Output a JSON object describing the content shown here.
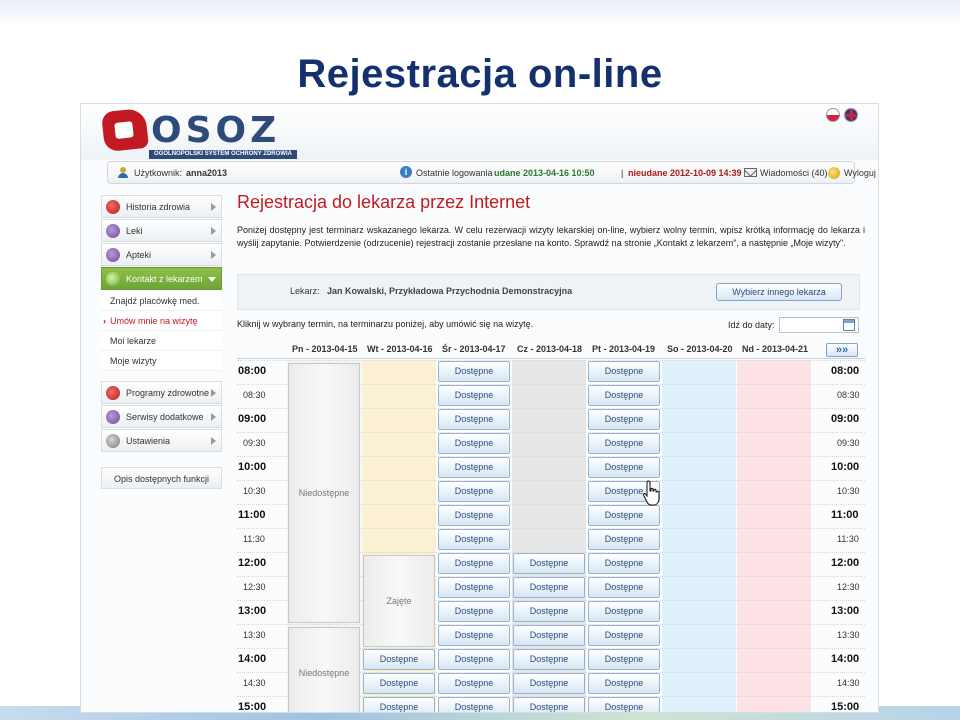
{
  "slide_title": "Rejestracja on-line",
  "logo": {
    "text": "OSOZ",
    "subtitle": "OGÓLNOPOLSKI SYSTEM OCHRONY ZDROWIA"
  },
  "user_bar": {
    "user_label": "Użytkownik:",
    "user_name": "anna2013",
    "last_login_label": "Ostatnie logowania",
    "last_ok": "udane 2013-04-16 10:50",
    "separator": "|",
    "last_fail": "nieudane 2012-10-09 14:39",
    "messages": "Wiadomości (40)",
    "logout": "Wyloguj"
  },
  "sidebar": {
    "items": [
      {
        "label": "Historia zdrowia",
        "icon": "heart-icon"
      },
      {
        "label": "Leki",
        "icon": "pill-icon"
      },
      {
        "label": "Apteki",
        "icon": "pharmacy-icon"
      },
      {
        "label": "Kontakt z lekarzem",
        "icon": "doctor-icon",
        "active": true
      }
    ],
    "sub_items": [
      "Znajdź placówkę med.",
      "Umów mnie na wizytę",
      "Moi lekarze",
      "Moje wizyty"
    ],
    "items2": [
      {
        "label": "Programy zdrowotne",
        "icon": "program-icon"
      },
      {
        "label": "Serwisy dodatkowe",
        "icon": "services-icon"
      },
      {
        "label": "Ustawienia",
        "icon": "settings-icon"
      }
    ],
    "functions_link": "Opis dostępnych funkcji"
  },
  "main": {
    "title": "Rejestracja do lekarza przez Internet",
    "intro": "Poniżej dostępny jest terminarz wskazanego lekarza. W celu rezerwacji wizyty lekarskiej on-line, wybierz wolny termin, wpisz krótką informację do lekarza i wyślij zapytanie. Potwierdzenie (odrzucenie) rejestracji zostanie przesłane na konto. Sprawdź na stronie „Kontakt z lekarzem\", a następnie „Moje wizyty\".",
    "doctor_label": "Lekarz:",
    "doctor_name": "Jan Kowalski, Przykładowa Przychodnia Demonstracyjna",
    "change_doctor": "Wybierz innego lekarza",
    "instruction": "Kliknij w wybrany termin, na terminarzu poniżej, aby umówić się na wizytę.",
    "date_label": "Idź do daty:",
    "date_value": "",
    "next_week": "»»"
  },
  "schedule": {
    "days": [
      "Pn - 2013-04-15",
      "Wt - 2013-04-16",
      "Śr - 2013-04-17",
      "Cz - 2013-04-18",
      "Pt - 2013-04-19",
      "So - 2013-04-20",
      "Nd - 2013-04-21"
    ],
    "day_colors": [
      "#f4f4f4",
      "#fbefd4",
      "#ffffff",
      "#e6e6e6",
      "#ffffff",
      "#dff1fb",
      "#fde3e5"
    ],
    "times": [
      "08:00",
      "08:30",
      "09:00",
      "09:30",
      "10:00",
      "10:30",
      "11:00",
      "11:30",
      "12:00",
      "12:30",
      "13:00",
      "13:30",
      "14:00",
      "14:30",
      "15:00"
    ],
    "available_label": "Dostępne",
    "unavailable_label": "Niedostępne",
    "busy_label": "Zajęte",
    "slots": [
      {
        "day": 2,
        "from": 0,
        "to": 14
      },
      {
        "day": 4,
        "from": 0,
        "to": 14
      },
      {
        "day": 3,
        "from": 8,
        "to": 14
      },
      {
        "day": 1,
        "from": 12,
        "to": 14
      }
    ],
    "blocks": [
      {
        "day": 0,
        "from": 0,
        "to": 11,
        "kind": "unavailable"
      },
      {
        "day": 0,
        "from": 11,
        "to": 15,
        "kind": "unavailable"
      },
      {
        "day": 1,
        "from": 8,
        "to": 12,
        "kind": "busy"
      }
    ]
  }
}
